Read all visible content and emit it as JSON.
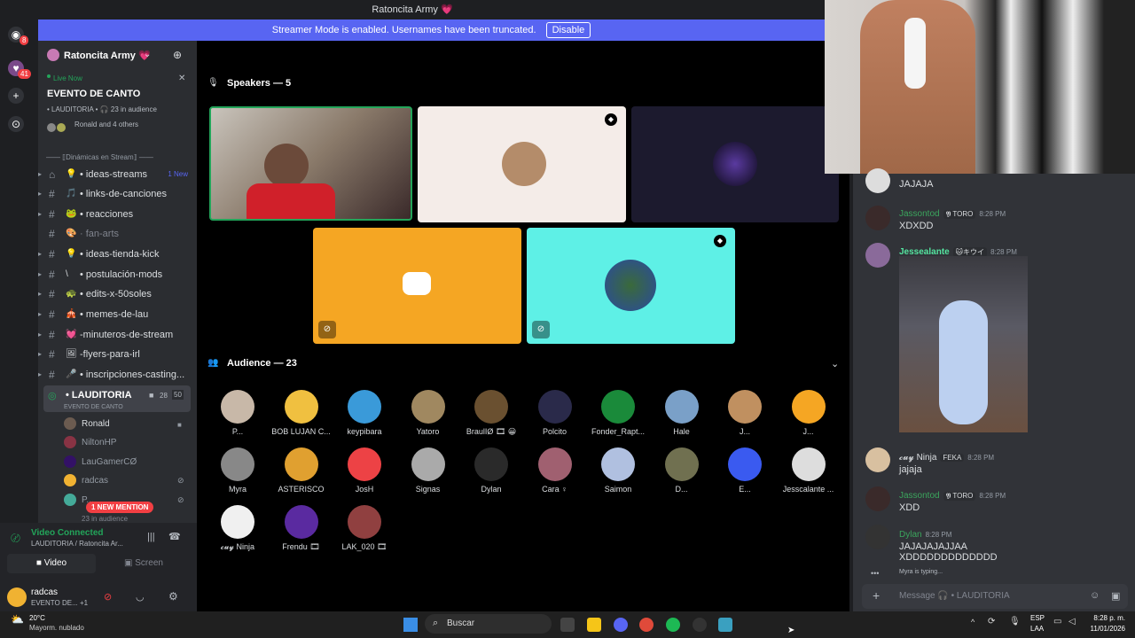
{
  "window": {
    "title": "Ratoncita Army 💗"
  },
  "streamer_banner": {
    "text": "Streamer Mode is enabled. Usernames have been truncated.",
    "button": "Disable"
  },
  "rail": {
    "badges": [
      "8",
      "41"
    ]
  },
  "server": {
    "name": "Ratoncita Army 💗"
  },
  "live_card": {
    "live_label": "Live Now",
    "event_name": "EVENTO DE CANTO",
    "channel_line": "• LAUDITORIA • 🎧 23 in audience",
    "others": "Ronald and 4 others"
  },
  "category": "—— ⟦Dinámicas en Stream⟧ ——",
  "channels": [
    {
      "emoji": "💡",
      "label": "• ideas-streams",
      "badge": "1 New"
    },
    {
      "emoji": "🎵",
      "label": "• links-de-canciones"
    },
    {
      "emoji": "🐸",
      "label": "• reacciones"
    },
    {
      "emoji": "🎨",
      "label": "· fan-arts"
    },
    {
      "emoji": "💡",
      "label": "• ideas-tienda-kick"
    },
    {
      "emoji": "\\",
      "label": "• postulación-mods"
    },
    {
      "emoji": "🐢",
      "label": "• edits-x-50soles"
    },
    {
      "emoji": "🎪",
      "label": "• memes-de-lau"
    },
    {
      "emoji": "💓",
      "label": "-minuteros-de-stream"
    },
    {
      "emoji": "🖼",
      "label": "-flyers-para-irl"
    },
    {
      "emoji": "🎤",
      "label": "• inscripciones-casting..."
    }
  ],
  "stage_channel": {
    "label": "• LAUDITORIA",
    "counts": "28",
    "limit": "50",
    "subtitle": "EVENTO DE CANTO"
  },
  "voice_users": [
    "Ronald",
    "NiltonHP",
    "LauGamerCØ",
    "radcas",
    "P..."
  ],
  "new_mention": "1 NEW MENTION",
  "in_audience": "23 in audience",
  "voice_panel": {
    "status": "Video Connected",
    "channel": "LAUDITORIA / Ratoncita Ar...",
    "video": "Video",
    "screen": "Screen"
  },
  "user_panel": {
    "name": "radcas",
    "sub": "EVENTO DE... +1"
  },
  "speakers": {
    "title": "Speakers — 5"
  },
  "audience": {
    "title": "Audience — 23",
    "members": [
      "P...",
      "BOB LUJAN C...",
      "keypibara",
      "Yatoro",
      "BraulIØ 🎞 😀",
      "Polcito",
      "Fonder_Rapt...",
      "Hale",
      "J...",
      "J...",
      "Myra",
      "ASTERISCO",
      "JosH",
      "Signas",
      "Dylan",
      "Cara ♀",
      "Saimon",
      "D...",
      "E...",
      "Jesscalante ...",
      "𝓬𝓾𝔂 Ninja",
      "Frendu 🎞",
      "LAK_020 🎞"
    ]
  },
  "chat": {
    "messages": [
      {
        "name": "",
        "time": "",
        "text": "JAJAJA"
      },
      {
        "name": "Jassontod",
        "tag": "𝖄 TORO",
        "time": "8:28 PM",
        "text": "XDXDD"
      },
      {
        "name": "Jessealante",
        "tag": "🐱キウイ",
        "time": "8:28 PM",
        "text": ""
      },
      {
        "name": "𝓬𝓾𝔂 Ninja",
        "tag": "FEKA",
        "time": "8:28 PM",
        "text": "jajaja"
      },
      {
        "name": "Jassontod",
        "tag": "𝖄 TORO",
        "time": "8:28 PM",
        "text": "XDD"
      },
      {
        "name": "Dylan",
        "time": "8:28 PM",
        "text": "JAJAJAJAJJAA"
      },
      {
        "name": "",
        "time": "",
        "text": "XDDDDDDDDDDDDD"
      }
    ],
    "typing": "Myra is typing...",
    "input_placeholder": "Message 🎧 • LAUDITORIA"
  },
  "taskbar": {
    "weather_temp": "20°C",
    "weather_desc": "Mayorm. nublado",
    "search": "Buscar",
    "lang": "ESP",
    "lang2": "LAA",
    "time": "8:28 p. m.",
    "date": "11/01/2026"
  }
}
